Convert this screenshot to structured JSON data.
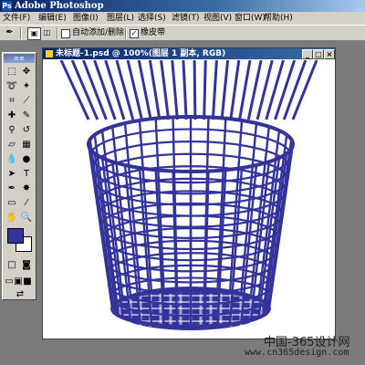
{
  "app": {
    "title": "Adobe Photoshop",
    "icon": "photoshop-icon"
  },
  "menu": [
    "文件(F)",
    "编辑(E)",
    "图像(I)",
    "图层(L)",
    "选择(S)",
    "滤镜(T)",
    "视图(V)",
    "窗口(W)",
    "帮助(H)"
  ],
  "options": {
    "auto_add_delete": "自动添加/删除",
    "auto_add_delete_checked": false,
    "rubber_band": "橡皮带",
    "rubber_band_checked": true
  },
  "document": {
    "title": "未标题-1.psd @ 100%(图层 1 副本, RGB)",
    "minimize": "_",
    "maximize": "□",
    "close": "×"
  },
  "colors": {
    "foreground": "#333399",
    "background": "#ffffff",
    "basket": "#33339a"
  },
  "watermark": {
    "line1": "中国-365设计网",
    "line2": "www.cn365design.com"
  }
}
